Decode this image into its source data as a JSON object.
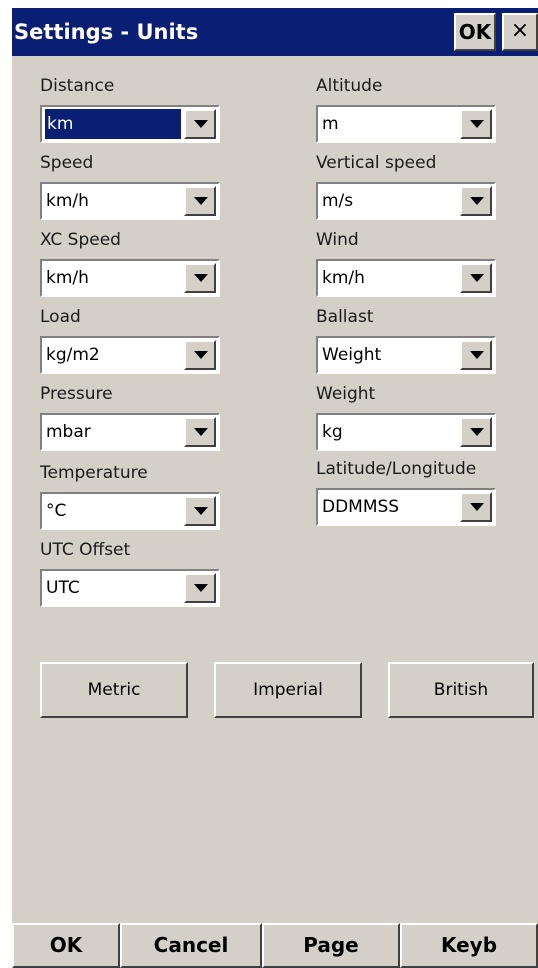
{
  "window": {
    "title": "Settings - Units",
    "ok_label": "OK",
    "close_label": "×"
  },
  "fields": {
    "distance": {
      "label": "Distance",
      "value": "km"
    },
    "altitude": {
      "label": "Altitude",
      "value": "m"
    },
    "speed": {
      "label": "Speed",
      "value": "km/h"
    },
    "vspeed": {
      "label": "Vertical speed",
      "value": "m/s"
    },
    "xcspeed": {
      "label": "XC Speed",
      "value": "km/h"
    },
    "wind": {
      "label": "Wind",
      "value": "km/h"
    },
    "load": {
      "label": "Load",
      "value": "kg/m2"
    },
    "ballast": {
      "label": "Ballast",
      "value": "Weight"
    },
    "pressure": {
      "label": "Pressure",
      "value": "mbar"
    },
    "weight": {
      "label": "Weight",
      "value": "kg"
    },
    "temperature": {
      "label": "Temperature",
      "value": "°C"
    },
    "latlon": {
      "label": "Latitude/Longitude",
      "value": "DDMMSS"
    },
    "utc": {
      "label": "UTC Offset",
      "value": "UTC"
    }
  },
  "presets": {
    "metric": "Metric",
    "imperial": "Imperial",
    "british": "British"
  },
  "bottom": {
    "ok": "OK",
    "cancel": "Cancel",
    "page": "Page",
    "keyb": "Keyb"
  }
}
